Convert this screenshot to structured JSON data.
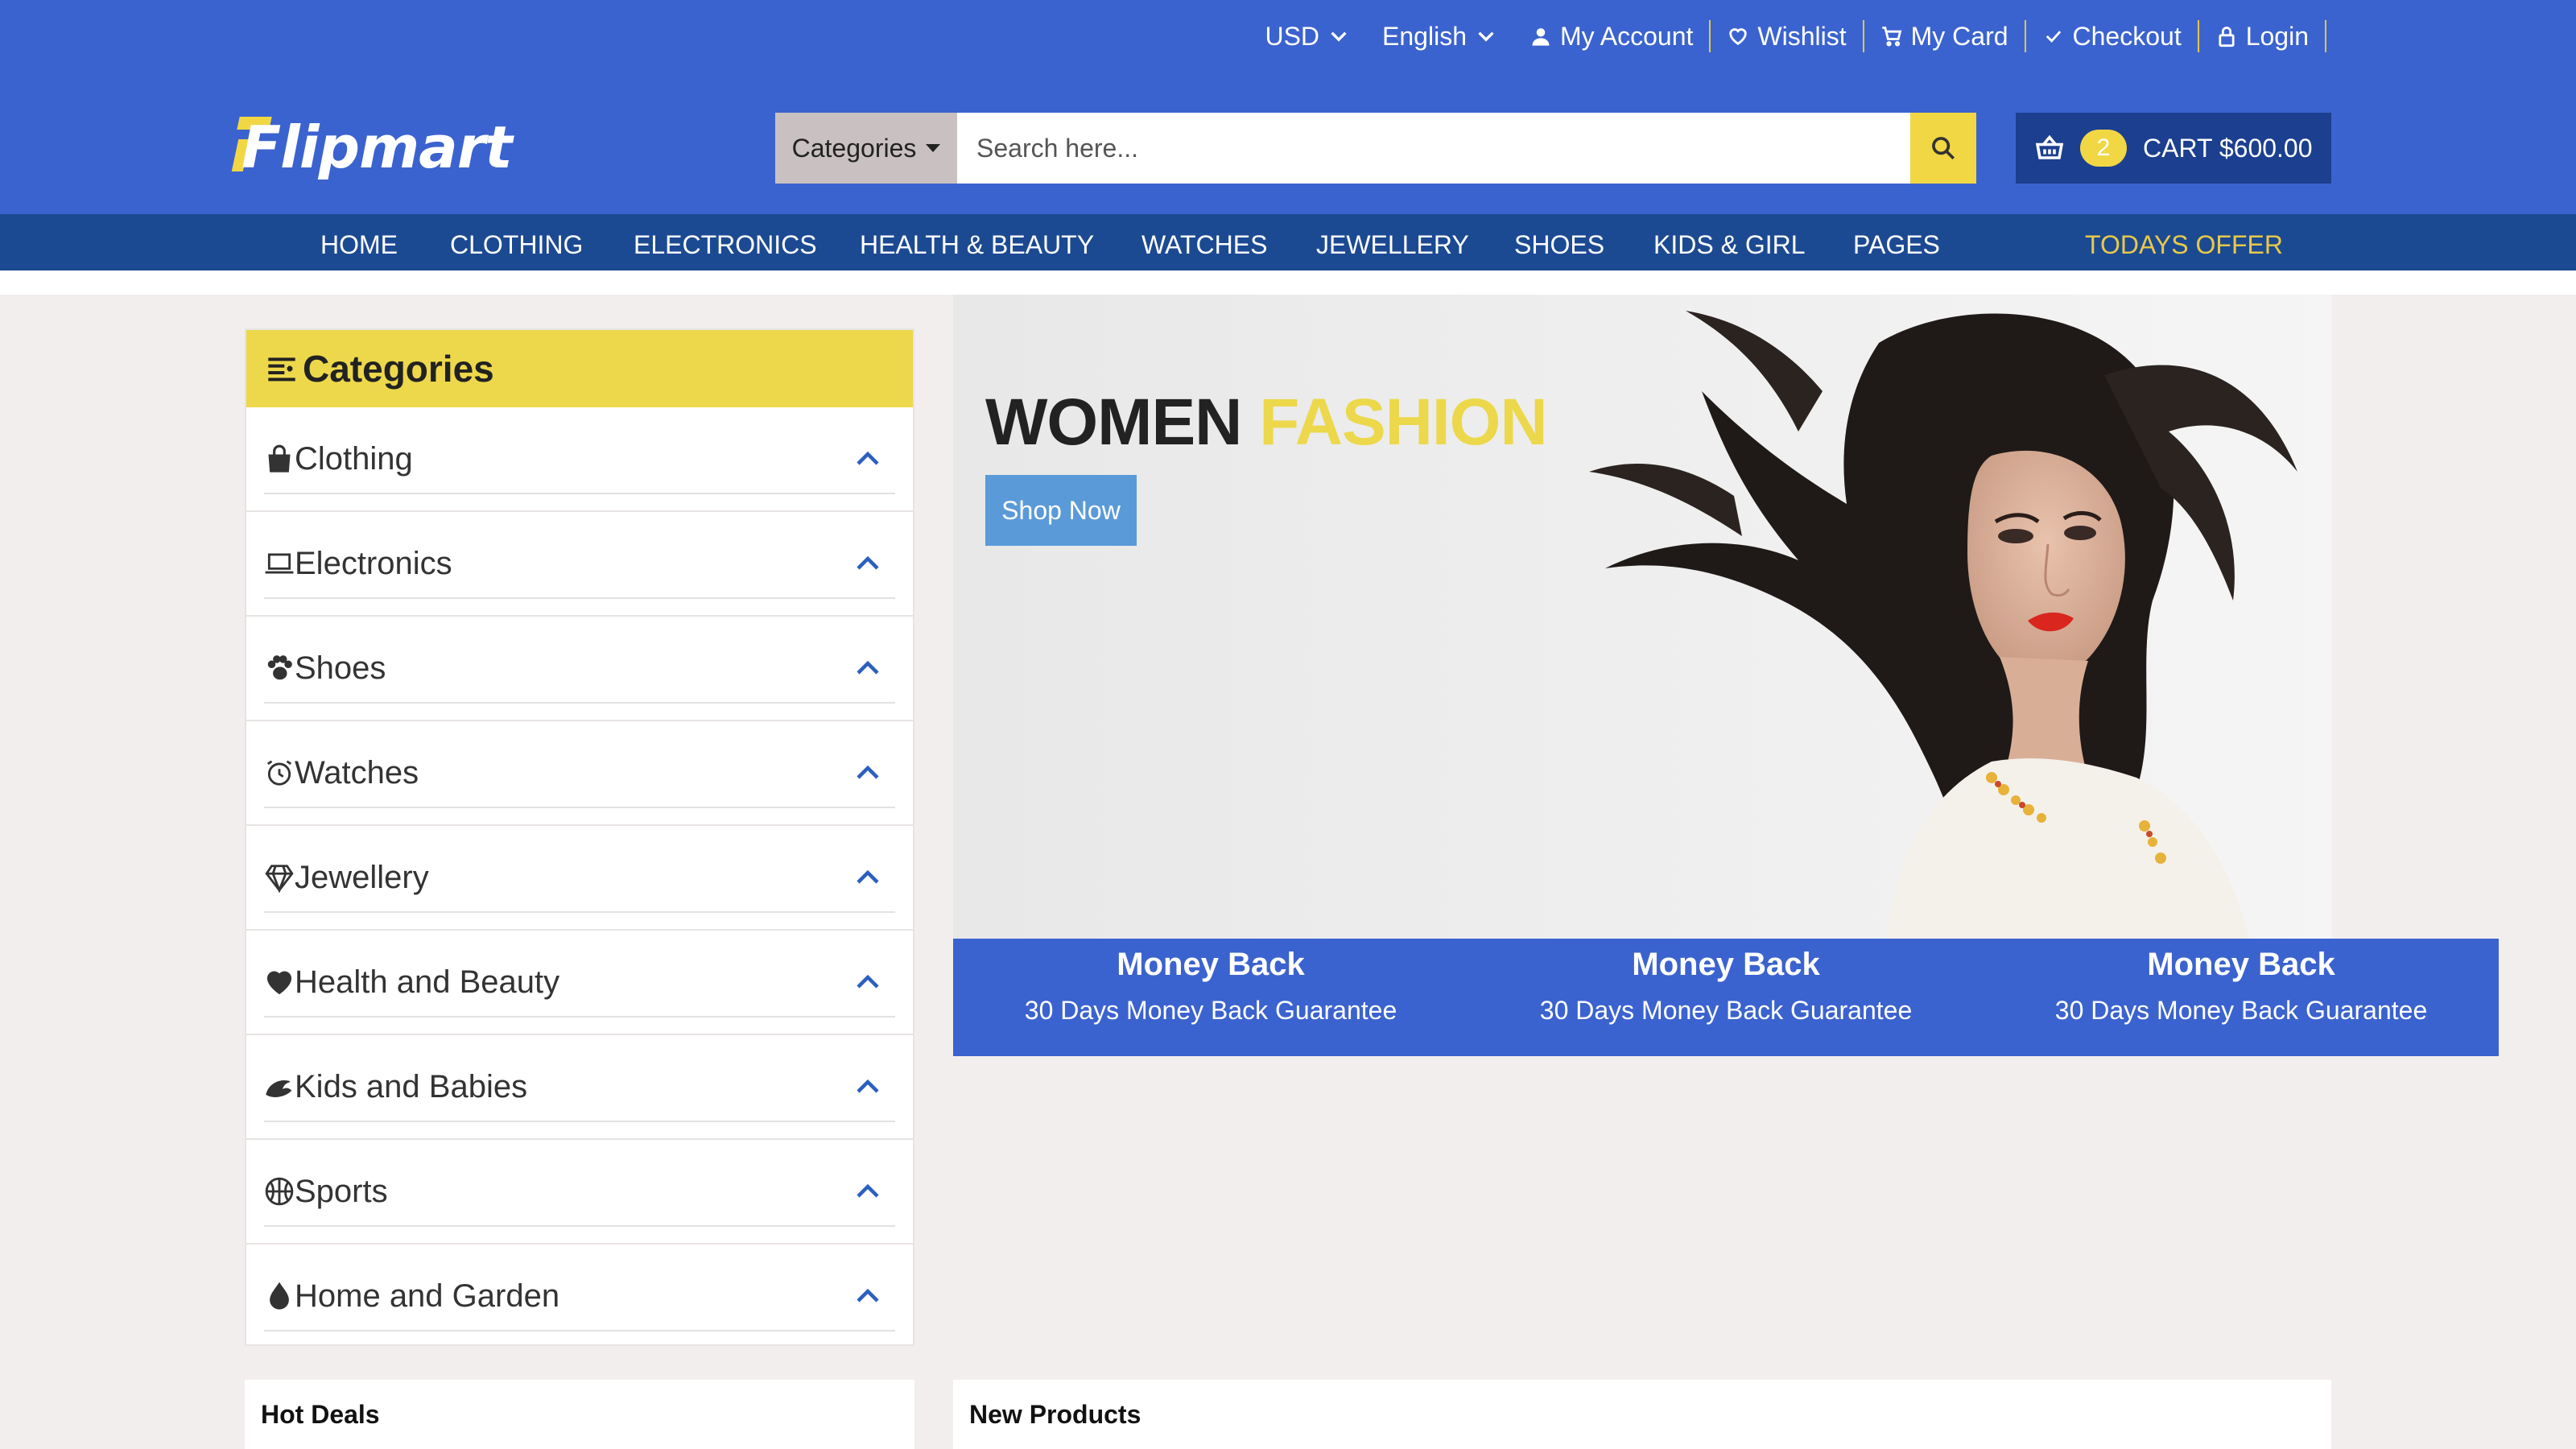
{
  "topbar": {
    "currency": "USD",
    "language": "English",
    "links": [
      {
        "label": "My Account",
        "icon": "user-icon"
      },
      {
        "label": "Wishlist",
        "icon": "heart-icon"
      },
      {
        "label": "My Card",
        "icon": "cart-icon"
      },
      {
        "label": "Checkout",
        "icon": "check-icon"
      },
      {
        "label": "Login",
        "icon": "lock-icon"
      }
    ]
  },
  "logo": {
    "text": "Flipmart"
  },
  "search": {
    "category_label": "Categories",
    "placeholder": "Search here..."
  },
  "cart": {
    "count": "2",
    "label": "CART $600.00"
  },
  "nav": {
    "items": [
      "HOME",
      "CLOTHING",
      "ELECTRONICS",
      "HEALTH & BEAUTY",
      "WATCHES",
      "JEWELLERY",
      "SHOES",
      "KIDS & GIRL",
      "PAGES"
    ],
    "offer": "TODAYS OFFER"
  },
  "sidebar": {
    "title": "Categories",
    "items": [
      {
        "label": "Clothing",
        "icon": "shopping-bag-icon"
      },
      {
        "label": "Electronics",
        "icon": "laptop-icon"
      },
      {
        "label": "Shoes",
        "icon": "paw-icon"
      },
      {
        "label": "Watches",
        "icon": "alarm-clock-icon"
      },
      {
        "label": "Jewellery",
        "icon": "diamond-icon"
      },
      {
        "label": "Health and Beauty",
        "icon": "heart-icon"
      },
      {
        "label": "Kids and Babies",
        "icon": "baby-icon"
      },
      {
        "label": "Sports",
        "icon": "basketball-icon"
      },
      {
        "label": "Home and Garden",
        "icon": "droplet-icon"
      }
    ]
  },
  "hero": {
    "title_main": "WOMEN",
    "title_accent": "FASHION",
    "button": "Shop Now"
  },
  "features": [
    {
      "title": "Money Back",
      "subtitle": "30 Days Money Back Guarantee"
    },
    {
      "title": "Money Back",
      "subtitle": "30 Days Money Back Guarantee"
    },
    {
      "title": "Money Back",
      "subtitle": "30 Days Money Back Guarantee"
    }
  ],
  "panels": {
    "hot_deals": "Hot Deals",
    "new_products": "New Products"
  },
  "colors": {
    "primary": "#3b63cf",
    "nav": "#1c4a92",
    "accent": "#ecd84a",
    "button": "#5a9ad8"
  }
}
